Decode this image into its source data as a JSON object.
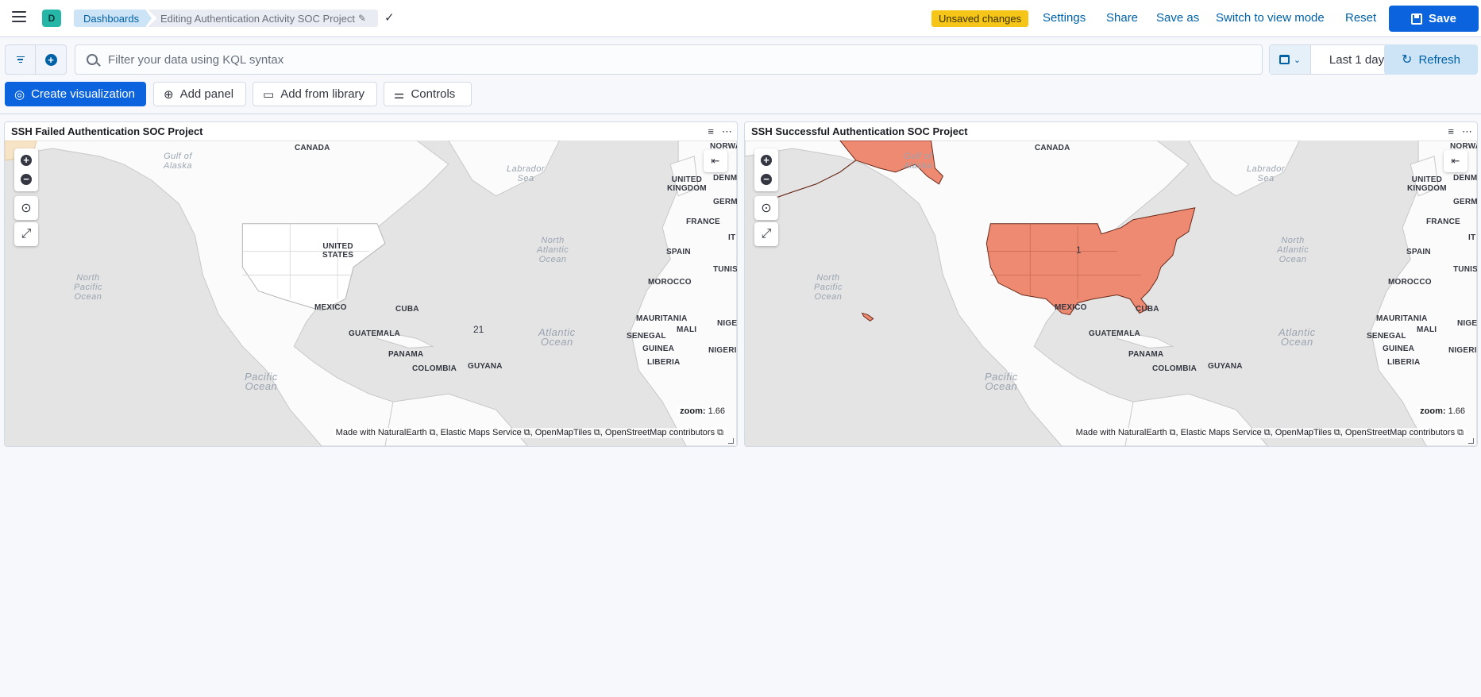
{
  "header": {
    "space_initial": "D",
    "breadcrumb_root": "Dashboards",
    "breadcrumb_current": "Editing Authentication Activity SOC Project",
    "unsaved_badge": "Unsaved changes",
    "links": {
      "settings": "Settings",
      "share": "Share",
      "save_as": "Save as",
      "switch_view": "Switch to view mode",
      "reset": "Reset"
    },
    "save_label": "Save"
  },
  "query": {
    "placeholder": "Filter your data using KQL syntax",
    "time_range": "Last 1 day",
    "refresh_label": "Refresh"
  },
  "controls": {
    "create_visualization": "Create visualization",
    "add_panel": "Add panel",
    "add_from_library": "Add from library",
    "controls": "Controls"
  },
  "panels": [
    {
      "title": "SSH Failed Authentication SOC Project",
      "cluster_count": "21",
      "zoom_label": "zoom:",
      "zoom_value": "1.66",
      "attribution": "Made with NaturalEarth ⧉, Elastic Maps Service ⧉, OpenMapTiles ⧉, OpenStreetMap contributors ⧉"
    },
    {
      "title": "SSH Successful Authentication SOC Project",
      "cluster_count": "1",
      "zoom_label": "zoom:",
      "zoom_value": "1.66",
      "attribution": "Made with NaturalEarth ⧉, Elastic Maps Service ⧉, OpenMapTiles ⧉, OpenStreetMap contributors ⧉"
    }
  ],
  "map_labels": {
    "canada": "CANADA",
    "united_states_1": "UNITED",
    "united_states_2": "STATES",
    "mexico": "MEXICO",
    "cuba": "CUBA",
    "guatemala": "GUATEMALA",
    "panama": "PANAMA",
    "colombia": "COLOMBIA",
    "guyana": "GUYANA",
    "united_kingdom_1": "UNITED",
    "united_kingdom_2": "KINGDOM",
    "france": "FRANCE",
    "spain": "SPAIN",
    "morocco": "MOROCCO",
    "mauritania": "MAURITANIA",
    "mali": "MALI",
    "senegal": "SENEGAL",
    "guinea": "GUINEA",
    "liberia": "LIBERIA",
    "nigeria": "NIGERIA",
    "niger": "NIGE",
    "tunisia": "TUNIS",
    "norway": "NORWA",
    "denmark": "DENM",
    "germany": "GERMA",
    "italy": "IT",
    "gulf_alaska_1": "Gulf of",
    "gulf_alaska_2": "Alaska",
    "labrador_1": "Labrador",
    "labrador_2": "Sea",
    "north_atlantic_1": "North",
    "north_atlantic_2": "Atlantic",
    "north_atlantic_3": "Ocean",
    "north_pacific_1": "North",
    "north_pacific_2": "Pacific",
    "north_pacific_3": "Ocean",
    "atlantic_1": "Atlantic",
    "atlantic_2": "Ocean",
    "pacific_1": "Pacific",
    "pacific_2": "Ocean"
  },
  "colors": {
    "accent": "#0b64dd",
    "highlight_region": "#ef8a72",
    "warning_badge": "#f5c518"
  }
}
